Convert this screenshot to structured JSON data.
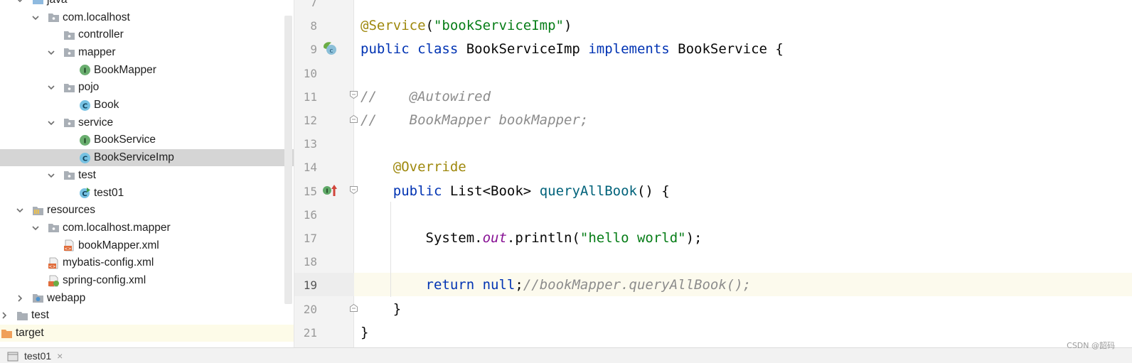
{
  "project_tree": {
    "items": [
      {
        "label": "java",
        "kind": "src-folder",
        "indent": 0,
        "expanded": true
      },
      {
        "label": "com.localhost",
        "kind": "package",
        "indent": 1,
        "expanded": true
      },
      {
        "label": "controller",
        "kind": "package",
        "indent": 2,
        "expanded": null
      },
      {
        "label": "mapper",
        "kind": "package",
        "indent": 2,
        "expanded": true
      },
      {
        "label": "BookMapper",
        "kind": "interface",
        "indent": 3,
        "expanded": null
      },
      {
        "label": "pojo",
        "kind": "package",
        "indent": 2,
        "expanded": true
      },
      {
        "label": "Book",
        "kind": "class",
        "indent": 3,
        "expanded": null
      },
      {
        "label": "service",
        "kind": "package",
        "indent": 2,
        "expanded": true
      },
      {
        "label": "BookService",
        "kind": "interface",
        "indent": 3,
        "expanded": null
      },
      {
        "label": "BookServiceImp",
        "kind": "class",
        "indent": 3,
        "expanded": null,
        "selected": true
      },
      {
        "label": "test",
        "kind": "package",
        "indent": 2,
        "expanded": true
      },
      {
        "label": "test01",
        "kind": "runnable-class",
        "indent": 3,
        "expanded": null
      },
      {
        "label": "resources",
        "kind": "res-folder",
        "indent": 0,
        "expanded": true
      },
      {
        "label": "com.localhost.mapper",
        "kind": "package",
        "indent": 1,
        "expanded": true
      },
      {
        "label": "bookMapper.xml",
        "kind": "xml",
        "indent": 2,
        "expanded": null
      },
      {
        "label": "mybatis-config.xml",
        "kind": "xml",
        "indent": 1,
        "expanded": null
      },
      {
        "label": "spring-config.xml",
        "kind": "spring-xml",
        "indent": 1,
        "expanded": null
      },
      {
        "label": "webapp",
        "kind": "web-folder",
        "indent": 0,
        "expanded": false
      },
      {
        "label": "test",
        "kind": "folder",
        "indent": -1,
        "expanded": false
      },
      {
        "label": "target",
        "kind": "excluded-folder",
        "indent": -2,
        "expanded": null
      }
    ]
  },
  "editor": {
    "lines": [
      {
        "num": "7",
        "tokens": []
      },
      {
        "num": "8",
        "tokens": [
          {
            "t": "@Service",
            "c": "ann"
          },
          {
            "t": "(",
            "c": "plain"
          },
          {
            "t": "\"bookServiceImp\"",
            "c": "str"
          },
          {
            "t": ")",
            "c": "plain"
          }
        ]
      },
      {
        "num": "9",
        "tokens": [
          {
            "t": "public ",
            "c": "kw"
          },
          {
            "t": "class ",
            "c": "kw"
          },
          {
            "t": "BookServiceImp ",
            "c": "plain"
          },
          {
            "t": "implements ",
            "c": "kw"
          },
          {
            "t": "BookService {",
            "c": "plain"
          }
        ]
      },
      {
        "num": "10",
        "tokens": []
      },
      {
        "num": "11",
        "tokens": [
          {
            "t": "//    @Autowired",
            "c": "cmt"
          }
        ]
      },
      {
        "num": "12",
        "tokens": [
          {
            "t": "//    BookMapper bookMapper;",
            "c": "cmt"
          }
        ]
      },
      {
        "num": "13",
        "tokens": []
      },
      {
        "num": "14",
        "tokens": [
          {
            "t": "    @Override",
            "c": "ann"
          }
        ]
      },
      {
        "num": "15",
        "tokens": [
          {
            "t": "    public ",
            "c": "kw"
          },
          {
            "t": "List<Book> ",
            "c": "plain"
          },
          {
            "t": "queryAllBook",
            "c": "mth"
          },
          {
            "t": "() {",
            "c": "plain"
          }
        ]
      },
      {
        "num": "16",
        "tokens": []
      },
      {
        "num": "17",
        "tokens": [
          {
            "t": "        System.",
            "c": "plain"
          },
          {
            "t": "out",
            "c": "fld"
          },
          {
            "t": ".println(",
            "c": "plain"
          },
          {
            "t": "\"hello world\"",
            "c": "str"
          },
          {
            "t": ");",
            "c": "plain"
          }
        ]
      },
      {
        "num": "18",
        "tokens": []
      },
      {
        "num": "19",
        "tokens": [
          {
            "t": "        return ",
            "c": "kw"
          },
          {
            "t": "null",
            "c": "kw"
          },
          {
            "t": ";",
            "c": "plain"
          },
          {
            "t": "//bookMapper.queryAllBook();",
            "c": "cmt"
          }
        ]
      },
      {
        "num": "20",
        "tokens": [
          {
            "t": "    }",
            "c": "plain"
          }
        ]
      },
      {
        "num": "21",
        "tokens": [
          {
            "t": "}",
            "c": "plain"
          }
        ]
      }
    ]
  },
  "tabbar": {
    "tab_label": "test01",
    "tab_close": "×"
  },
  "watermark": "CSDN @韶码"
}
